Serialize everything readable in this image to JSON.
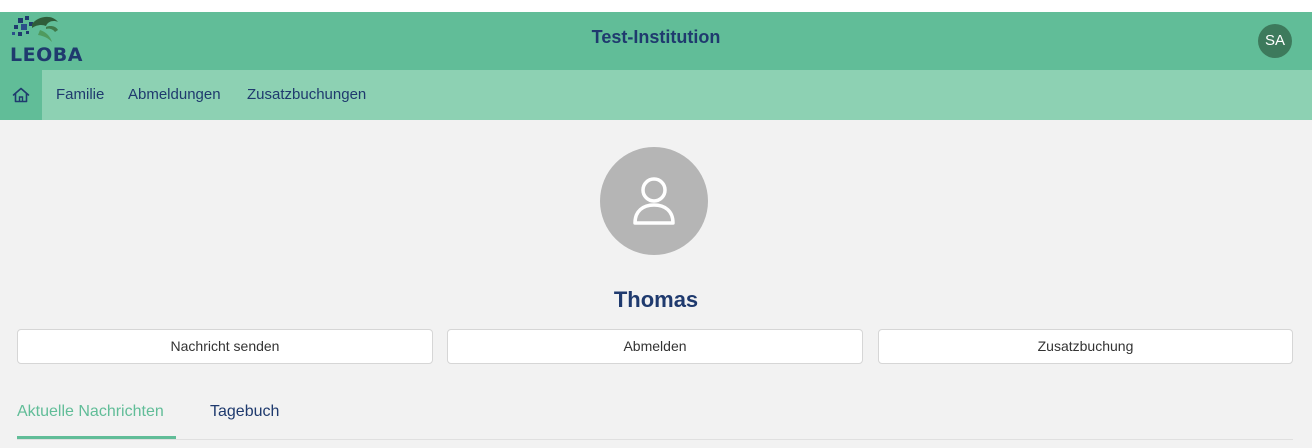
{
  "header": {
    "logo_text": "LEOBA",
    "title": "Test-Institution",
    "user_initials": "SA"
  },
  "nav": {
    "home_icon": "home-icon",
    "items": [
      {
        "label": "Familie"
      },
      {
        "label": "Abmeldungen"
      },
      {
        "label": "Zusatzbuchungen"
      }
    ]
  },
  "profile": {
    "avatar_icon": "user-icon",
    "name": "Thomas"
  },
  "actions": {
    "send_message": "Nachricht senden",
    "deregister": "Abmelden",
    "extra_booking": "Zusatzbuchung"
  },
  "tabs": [
    {
      "label": "Aktuelle Nachrichten",
      "active": true
    },
    {
      "label": "Tagebuch",
      "active": false
    }
  ],
  "colors": {
    "accent": "#61bd98",
    "nav_bg": "#8dd1b3",
    "text_primary": "#1f3a6e",
    "avatar_gray": "#b5b5b5",
    "badge_bg": "#3d7a5c"
  }
}
